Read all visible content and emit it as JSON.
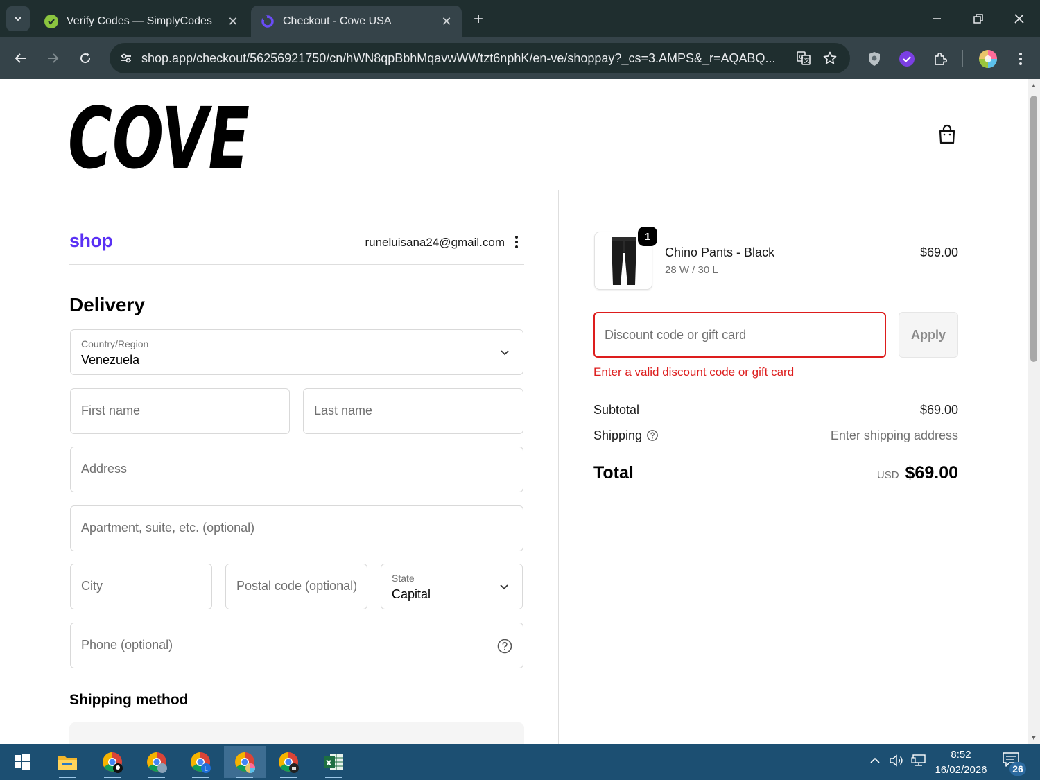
{
  "browser": {
    "tabs": [
      {
        "title": "Verify Codes — SimplyCodes",
        "icon": "simplycodes-icon",
        "active": false
      },
      {
        "title": "Checkout - Cove USA",
        "icon": "shop-pay-icon",
        "active": true
      }
    ],
    "url": "shop.app/checkout/56256921750/cn/hWN8qpBbhMqavwWWtzt6nphK/en-ve/shoppay?_cs=3.AMPS&_r=AQABQ..."
  },
  "store": {
    "brand": "COVE"
  },
  "account": {
    "shop_logo": "shop",
    "email": "runeluisana24@gmail.com"
  },
  "delivery": {
    "heading": "Delivery",
    "country_label": "Country/Region",
    "country_value": "Venezuela",
    "first_name_placeholder": "First name",
    "last_name_placeholder": "Last name",
    "address_placeholder": "Address",
    "apartment_placeholder": "Apartment, suite, etc. (optional)",
    "city_placeholder": "City",
    "postal_placeholder": "Postal code (optional)",
    "state_label": "State",
    "state_value": "Capital",
    "phone_placeholder": "Phone (optional)"
  },
  "shipping_method": {
    "heading": "Shipping method"
  },
  "order": {
    "item": {
      "name": "Chino Pants - Black",
      "variant": "28 W / 30 L",
      "price": "$69.00",
      "quantity": "1"
    },
    "discount_placeholder": "Discount code or gift card",
    "apply_label": "Apply",
    "discount_error": "Enter a valid discount code or gift card",
    "subtotal_label": "Subtotal",
    "subtotal_value": "$69.00",
    "shipping_label": "Shipping",
    "shipping_value": "Enter shipping address",
    "total_label": "Total",
    "total_currency": "USD",
    "total_value": "$69.00"
  },
  "taskbar": {
    "time": "8:52",
    "date": "16/02/2026",
    "notifications": "26"
  },
  "colors": {
    "shop_purple": "#5a31f4",
    "error_red": "#dd1d1d",
    "chrome_dark": "#1f2e2f",
    "chrome_toolbar": "#354349",
    "taskbar": "#1c4f72"
  }
}
